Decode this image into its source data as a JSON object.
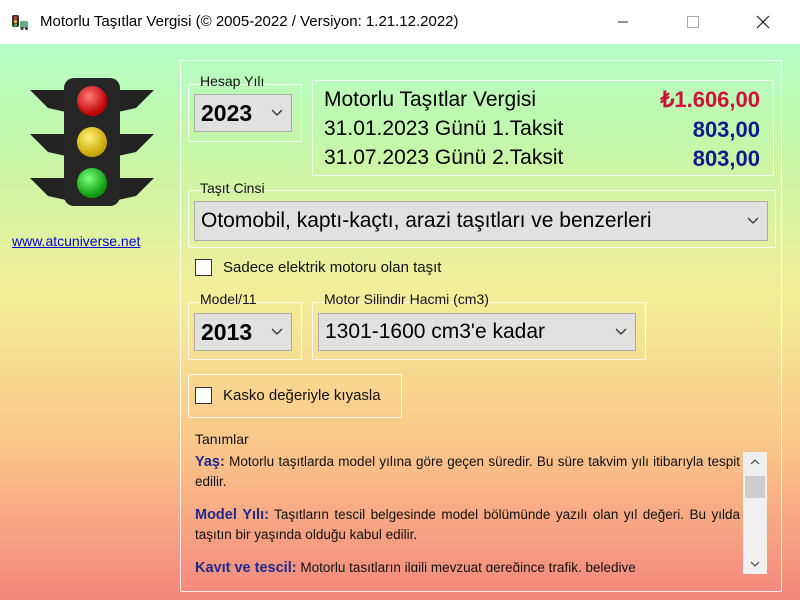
{
  "window": {
    "title": "Motorlu Taşıtlar Vergisi (©  2005-2022 / Versiyon: 1.21.12.2022)",
    "minimize_icon": "minimize-icon",
    "maximize_icon": "maximize-icon",
    "close_icon": "close-icon"
  },
  "sidebar": {
    "logo_icon": "traffic-light-icon",
    "website_link": "www.atcuniverse.net"
  },
  "hesap_yili": {
    "label": "Hesap Yılı",
    "selected": "2023"
  },
  "tax": {
    "title": "Motorlu Taşıtlar Vergisi",
    "total": "₺1.606,00",
    "installments": [
      {
        "label": "31.01.2023  Günü 1.Taksit",
        "amount": "803,00"
      },
      {
        "label": "31.07.2023  Günü 2.Taksit",
        "amount": "803,00"
      }
    ]
  },
  "vehicle_type": {
    "label": "Taşıt Cinsi",
    "selected": "Otomobil, kaptı-kaçtı, arazi taşıtları ve benzerleri"
  },
  "electric_checkbox": {
    "label": "Sadece elektrik motoru olan taşıt",
    "checked": false
  },
  "model_year": {
    "label": "Model/11",
    "selected": "2013"
  },
  "engine_capacity": {
    "label": "Motor Silindir Hacmi (cm3)",
    "selected": "1301-1600 cm3'e kadar"
  },
  "kasko_checkbox": {
    "label": "Kasko değeriyle kıyasla",
    "checked": false
  },
  "definitions": {
    "title": "Tanımlar",
    "items": [
      {
        "term": "Yaş:",
        "text": "Motorlu taşıtlarda model yılına göre geçen süredir. Bu süre takvim yılı itibarıyla tespit edilir."
      },
      {
        "term": "Model Yılı:",
        "text": "Taşıtların tescil belgesinde model bölümünde yazılı olan yıl değeri. Bu yılda taşıtın bir yaşında olduğu kabul edilir."
      },
      {
        "term": "Kayıt ve tescil:",
        "text": "Motorlu taşıtların ilgili mevzuat gereğince trafik, belediye"
      }
    ]
  },
  "colors": {
    "total": "#d0103a",
    "amount": "#101a8c",
    "term": "#1d2b8c"
  }
}
